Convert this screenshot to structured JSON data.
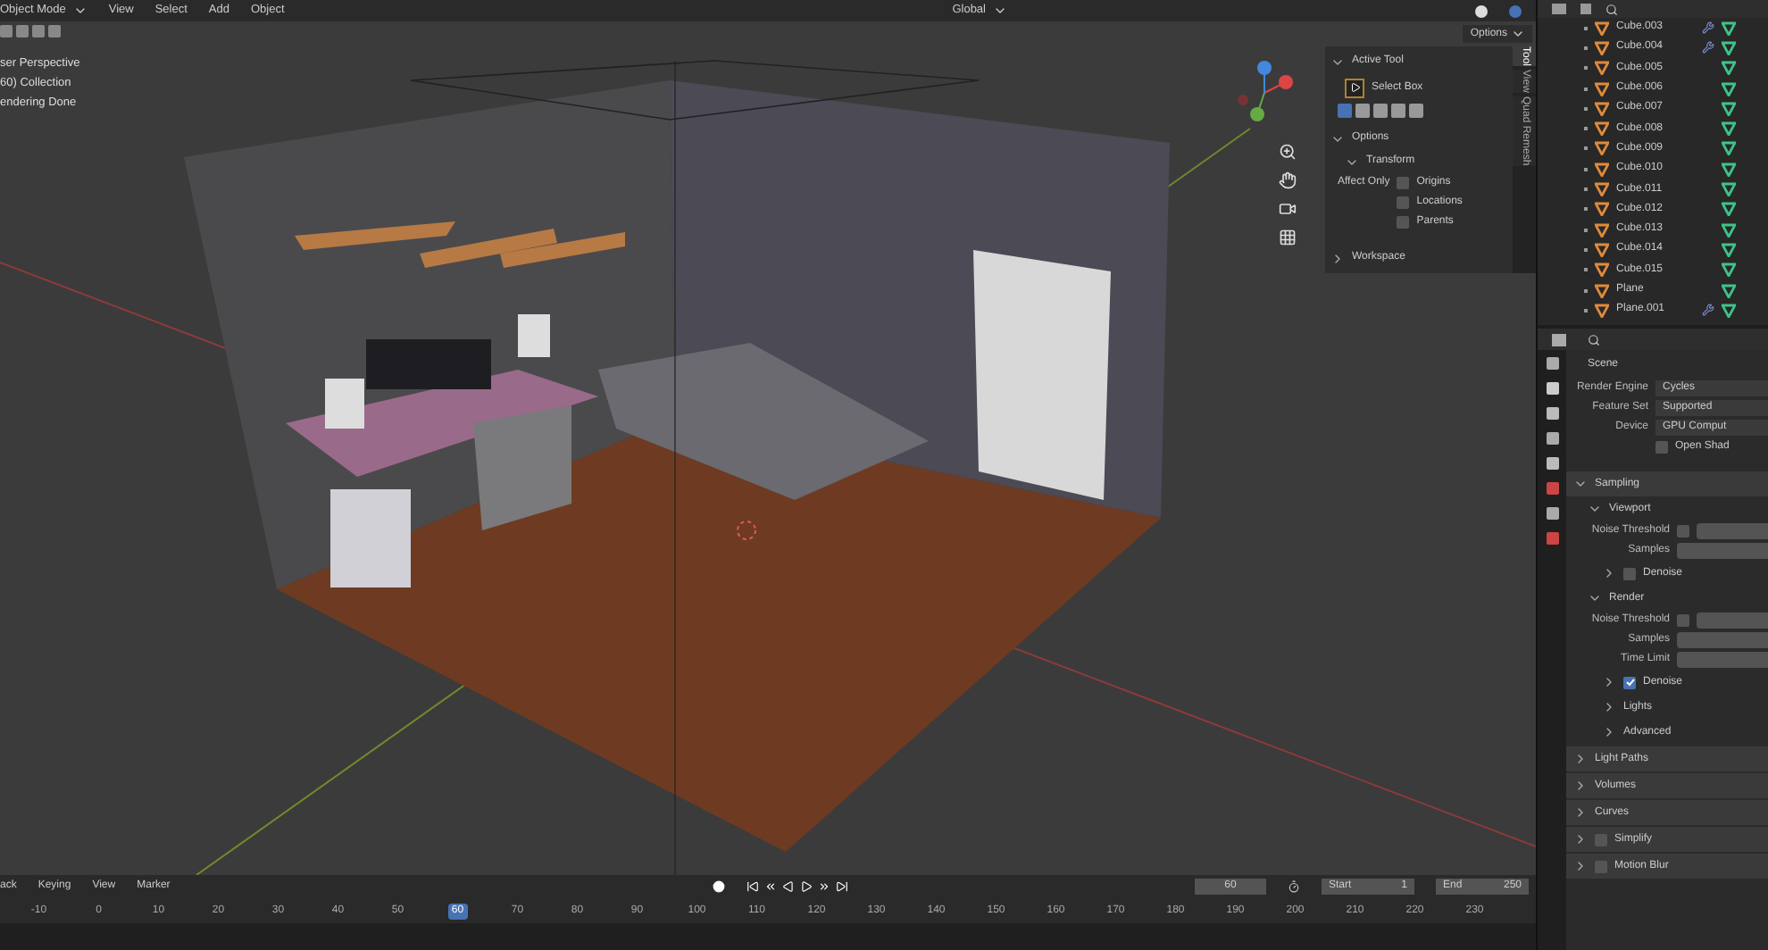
{
  "viewport_header": {
    "mode": "Object Mode",
    "menus": [
      "View",
      "Select",
      "Add",
      "Object"
    ],
    "orientation": "Global",
    "options_button": "Options"
  },
  "viewport_info": [
    "ser Perspective",
    "60) Collection",
    "endering Done"
  ],
  "sidebar": {
    "tabs": [
      {
        "label": "Tool",
        "selected": true
      },
      {
        "label": "View",
        "selected": false
      },
      {
        "label": "Quad Remesh",
        "selected": false
      }
    ],
    "active_tool": {
      "title": "Active Tool",
      "expanded": true,
      "tool": "Select Box"
    },
    "options": {
      "title": "Options",
      "expanded": true,
      "transform": {
        "title": "Transform",
        "expanded": true
      },
      "affect_only": "Affect Only",
      "checkboxes": [
        {
          "label": "Origins",
          "checked": false
        },
        {
          "label": "Locations",
          "checked": false
        },
        {
          "label": "Parents",
          "checked": false
        }
      ]
    },
    "workspace": {
      "title": "Workspace",
      "expanded": false
    }
  },
  "outliner": {
    "items": [
      {
        "name": "Cube.003",
        "modifier": true
      },
      {
        "name": "Cube.004",
        "modifier": true
      },
      {
        "name": "Cube.005",
        "modifier": false
      },
      {
        "name": "Cube.006",
        "modifier": false
      },
      {
        "name": "Cube.007",
        "modifier": false
      },
      {
        "name": "Cube.008",
        "modifier": false
      },
      {
        "name": "Cube.009",
        "modifier": false
      },
      {
        "name": "Cube.010",
        "modifier": false
      },
      {
        "name": "Cube.011",
        "modifier": false
      },
      {
        "name": "Cube.012",
        "modifier": false
      },
      {
        "name": "Cube.013",
        "modifier": false
      },
      {
        "name": "Cube.014",
        "modifier": false
      },
      {
        "name": "Cube.015",
        "modifier": false
      },
      {
        "name": "Plane",
        "modifier": false
      },
      {
        "name": "Plane.001",
        "modifier": true
      }
    ]
  },
  "properties": {
    "context": "Scene",
    "fields": [
      {
        "kind": "dropdown",
        "label": "Render Engine",
        "value": "Cycles"
      },
      {
        "kind": "dropdown",
        "label": "Feature Set",
        "value": "Supported"
      },
      {
        "kind": "dropdown",
        "label": "Device",
        "value": "GPU Comput"
      },
      {
        "kind": "checkbox",
        "label": "Open Shad",
        "checked": false
      }
    ],
    "panels": [
      {
        "title": "Sampling",
        "expanded": true,
        "children": [
          {
            "title": "Viewport",
            "expanded": true,
            "rows": [
              {
                "kind": "checkbox_value",
                "label": "Noise Threshold",
                "checked": false
              },
              {
                "kind": "value",
                "label": "Samples"
              }
            ],
            "children": [
              {
                "title": "Denoise",
                "expanded": false,
                "checked": false
              }
            ]
          },
          {
            "title": "Render",
            "expanded": true,
            "rows": [
              {
                "kind": "checkbox_value",
                "label": "Noise Threshold",
                "checked": false
              },
              {
                "kind": "value",
                "label": "Samples"
              },
              {
                "kind": "value",
                "label": "Time Limit"
              }
            ],
            "children": [
              {
                "title": "Denoise",
                "expanded": false,
                "checked": true
              },
              {
                "title": "Lights",
                "expanded": false
              },
              {
                "title": "Advanced",
                "expanded": false
              }
            ]
          }
        ]
      },
      {
        "title": "Light Paths",
        "expanded": false
      },
      {
        "title": "Volumes",
        "expanded": false
      },
      {
        "title": "Curves",
        "expanded": false
      },
      {
        "title": "Simplify",
        "expanded": false,
        "checked": false
      },
      {
        "title": "Motion Blur",
        "expanded": false,
        "checked": false
      }
    ]
  },
  "timeline": {
    "menus": [
      "ack",
      "Keying",
      "View",
      "Marker"
    ],
    "current_frame": "60",
    "start_label": "Start",
    "start": "1",
    "end_label": "End",
    "end": "250",
    "ticks": [
      {
        "label": "-10",
        "selected": false
      },
      {
        "label": "0",
        "selected": false
      },
      {
        "label": "10",
        "selected": false
      },
      {
        "label": "20",
        "selected": false
      },
      {
        "label": "30",
        "selected": false
      },
      {
        "label": "40",
        "selected": false
      },
      {
        "label": "50",
        "selected": false
      },
      {
        "label": "60",
        "selected": true
      },
      {
        "label": "70",
        "selected": false
      },
      {
        "label": "80",
        "selected": false
      },
      {
        "label": "90",
        "selected": false
      },
      {
        "label": "100",
        "selected": false
      },
      {
        "label": "110",
        "selected": false
      },
      {
        "label": "120",
        "selected": false
      },
      {
        "label": "130",
        "selected": false
      },
      {
        "label": "140",
        "selected": false
      },
      {
        "label": "150",
        "selected": false
      },
      {
        "label": "160",
        "selected": false
      },
      {
        "label": "170",
        "selected": false
      },
      {
        "label": "180",
        "selected": false
      },
      {
        "label": "190",
        "selected": false
      },
      {
        "label": "200",
        "selected": false
      },
      {
        "label": "210",
        "selected": false
      },
      {
        "label": "220",
        "selected": false
      },
      {
        "label": "230",
        "selected": false
      }
    ]
  }
}
